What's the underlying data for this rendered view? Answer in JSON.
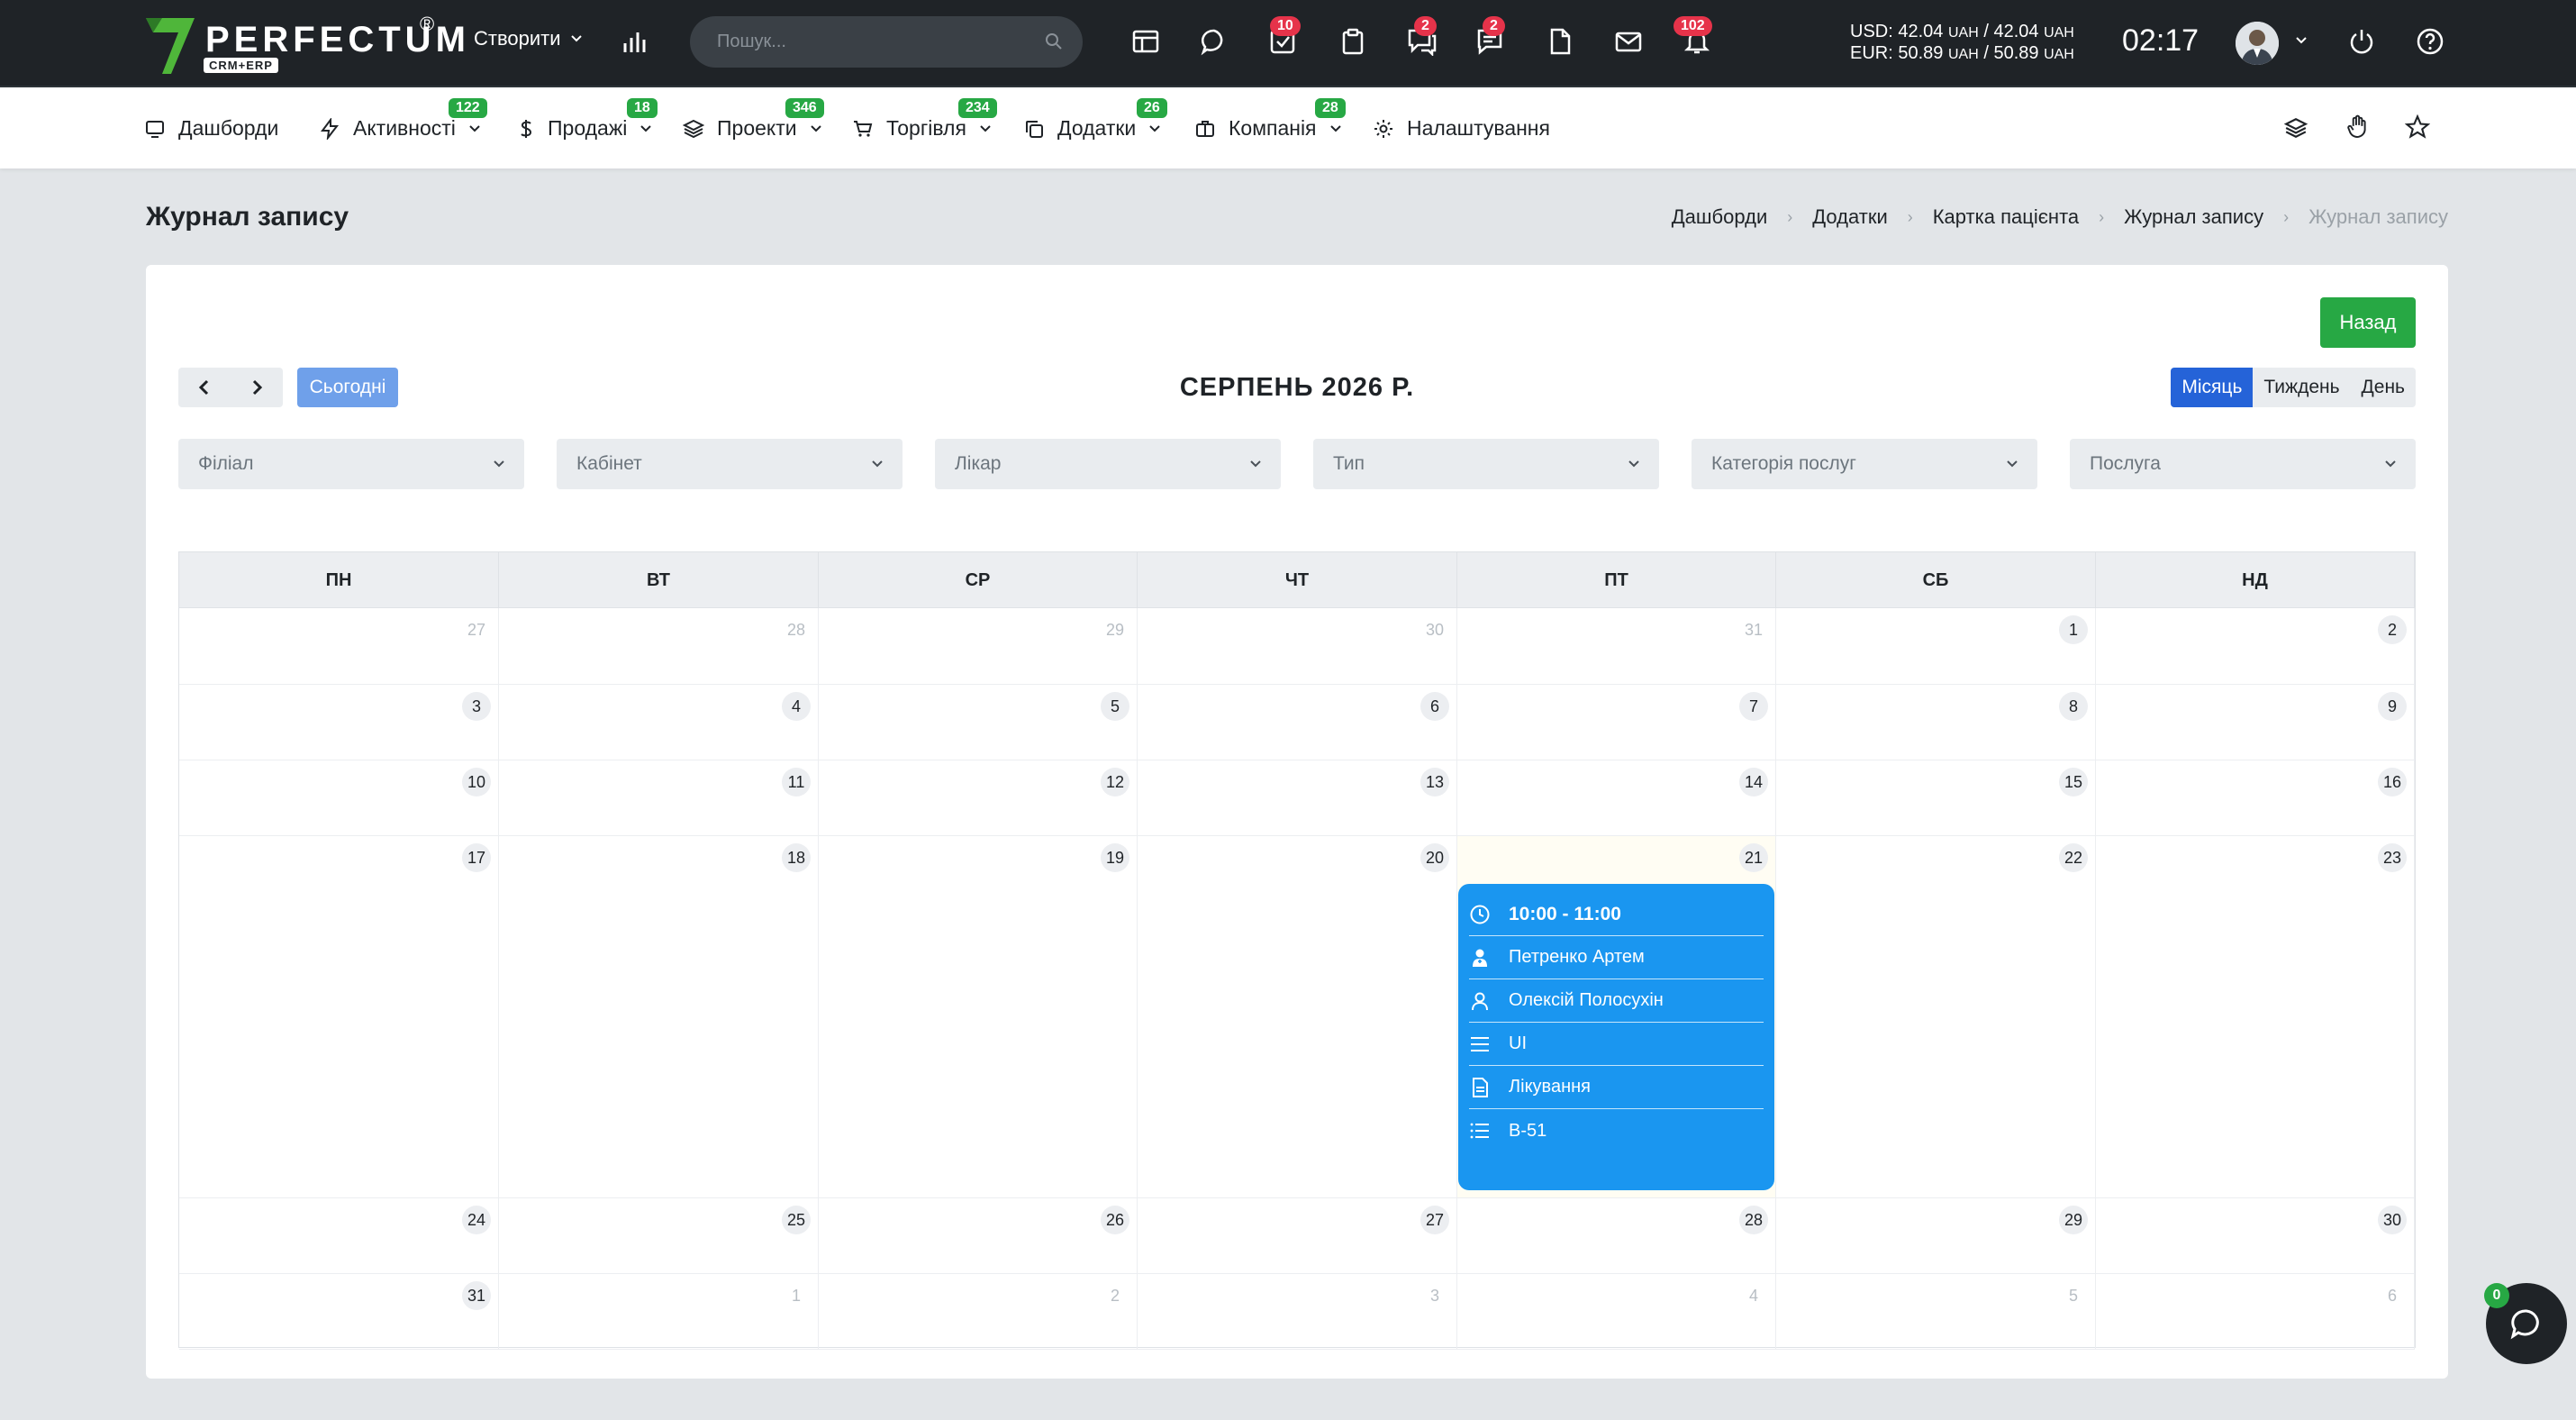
{
  "topbar": {
    "logo_text": "PERFECTUM",
    "logo_reg": "®",
    "logo_sub": "CRM+ERP",
    "create_label": "Створити",
    "search_placeholder": "Пошук...",
    "badges": {
      "tasks": "10",
      "chat": "2",
      "comments": "2",
      "notifications": "102"
    },
    "rates": {
      "usd_label": "USD:",
      "usd_value": "42.04",
      "usd_sep": "/",
      "usd_value2": "42.04",
      "eur_label": "EUR:",
      "eur_value": "50.89",
      "eur_sep": "/",
      "eur_value2": "50.89",
      "unit": "UAH"
    },
    "time": "02:17"
  },
  "nav": {
    "items": [
      {
        "label": "Дашборди",
        "icon": "monitor-icon"
      },
      {
        "label": "Активності",
        "icon": "bolt-icon",
        "badge": "122"
      },
      {
        "label": "Продажі",
        "icon": "dollar-icon",
        "badge": "18"
      },
      {
        "label": "Проекти",
        "icon": "layers-icon",
        "badge": "346"
      },
      {
        "label": "Торгівля",
        "icon": "cart-icon",
        "badge": "234"
      },
      {
        "label": "Додатки",
        "icon": "copy-icon",
        "badge": "26"
      },
      {
        "label": "Компанія",
        "icon": "briefcase-icon",
        "badge": "28"
      },
      {
        "label": "Налаштування",
        "icon": "gear-icon"
      }
    ]
  },
  "page": {
    "title": "Журнал запису",
    "breadcrumb": [
      "Дашборди",
      "Додатки",
      "Картка пацієнта",
      "Журнал запису",
      "Журнал запису"
    ]
  },
  "calendar": {
    "back_label": "Назад",
    "today_label": "Сьогодні",
    "title": "СЕРПЕНЬ 2026 Р.",
    "views": [
      "Місяць",
      "Тиждень",
      "День"
    ],
    "filters": [
      "Філіал",
      "Кабінет",
      "Лікар",
      "Тип",
      "Категорія послуг",
      "Послуга"
    ],
    "weekdays": [
      "ПН",
      "ВТ",
      "СР",
      "ЧТ",
      "ПТ",
      "СБ",
      "НД"
    ],
    "weeks": [
      [
        "27",
        "28",
        "29",
        "30",
        "31",
        "1",
        "2"
      ],
      [
        "3",
        "4",
        "5",
        "6",
        "7",
        "8",
        "9"
      ],
      [
        "10",
        "11",
        "12",
        "13",
        "14",
        "15",
        "16"
      ],
      [
        "17",
        "18",
        "19",
        "20",
        "21",
        "22",
        "23"
      ],
      [
        "24",
        "25",
        "26",
        "27",
        "28",
        "29",
        "30"
      ],
      [
        "31",
        "1",
        "2",
        "3",
        "4",
        "5",
        "6"
      ]
    ],
    "event": {
      "time": "10:00 - 11:00",
      "doctor": "Петренко Артем",
      "patient": "Олексій Полосухін",
      "type": "UI",
      "category": "Лікування",
      "service": "В-51"
    }
  },
  "chat": {
    "badge": "0"
  }
}
